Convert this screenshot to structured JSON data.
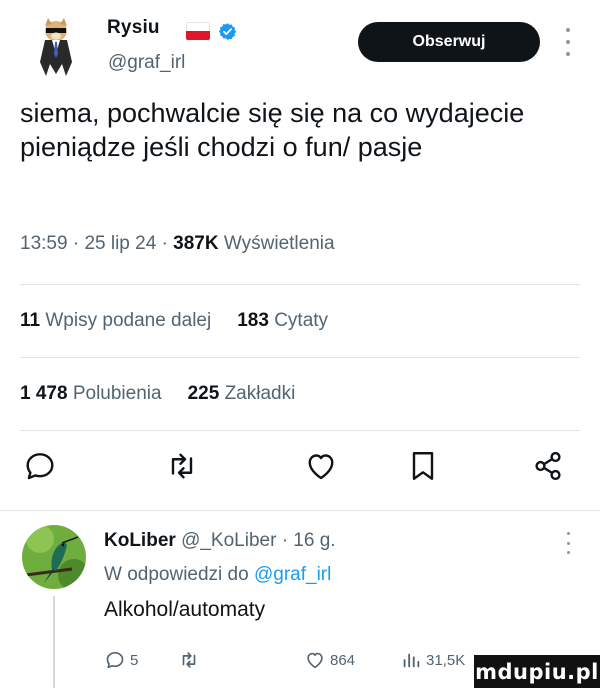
{
  "author": {
    "name": "Rysiu",
    "handle": "@graf_irl",
    "flag_colors": [
      "#ffffff",
      "#e0162b"
    ],
    "verified_color": "#1d9bf0"
  },
  "follow_label": "Obserwuj",
  "tweet": {
    "text": "siema, pochwalcie się się na co wydajecie pieniądze jeśli chodzi o fun/ pasje",
    "time": "13:59",
    "date": "25 lip 24",
    "views_value": "387K",
    "views_label": "Wyświetlenia",
    "separator": "·"
  },
  "stats": {
    "reposts_value": "11",
    "reposts_label": "Wpisy podane dalej",
    "quotes_value": "183",
    "quotes_label": "Cytaty",
    "likes_value": "1 478",
    "likes_label": "Polubienia",
    "bookmarks_value": "225",
    "bookmarks_label": "Zakładki"
  },
  "actions": [
    "reply-icon",
    "repost-icon",
    "like-icon",
    "bookmark-icon",
    "share-icon"
  ],
  "reply": {
    "name": "KoLiber",
    "handle": "@_KoLiber",
    "age": "16 g.",
    "reply_prefix": "W odpowiedzi do",
    "reply_handle": "@graf_irl",
    "text": "Alkohol/automaty",
    "replies": "5",
    "likes": "864",
    "views": "31,5K"
  },
  "watermark": "mdupiu.pl",
  "colors": {
    "text": "#0f1419",
    "secondary": "#536471",
    "accent": "#1d9bf0",
    "divider": "#dde3e7"
  }
}
